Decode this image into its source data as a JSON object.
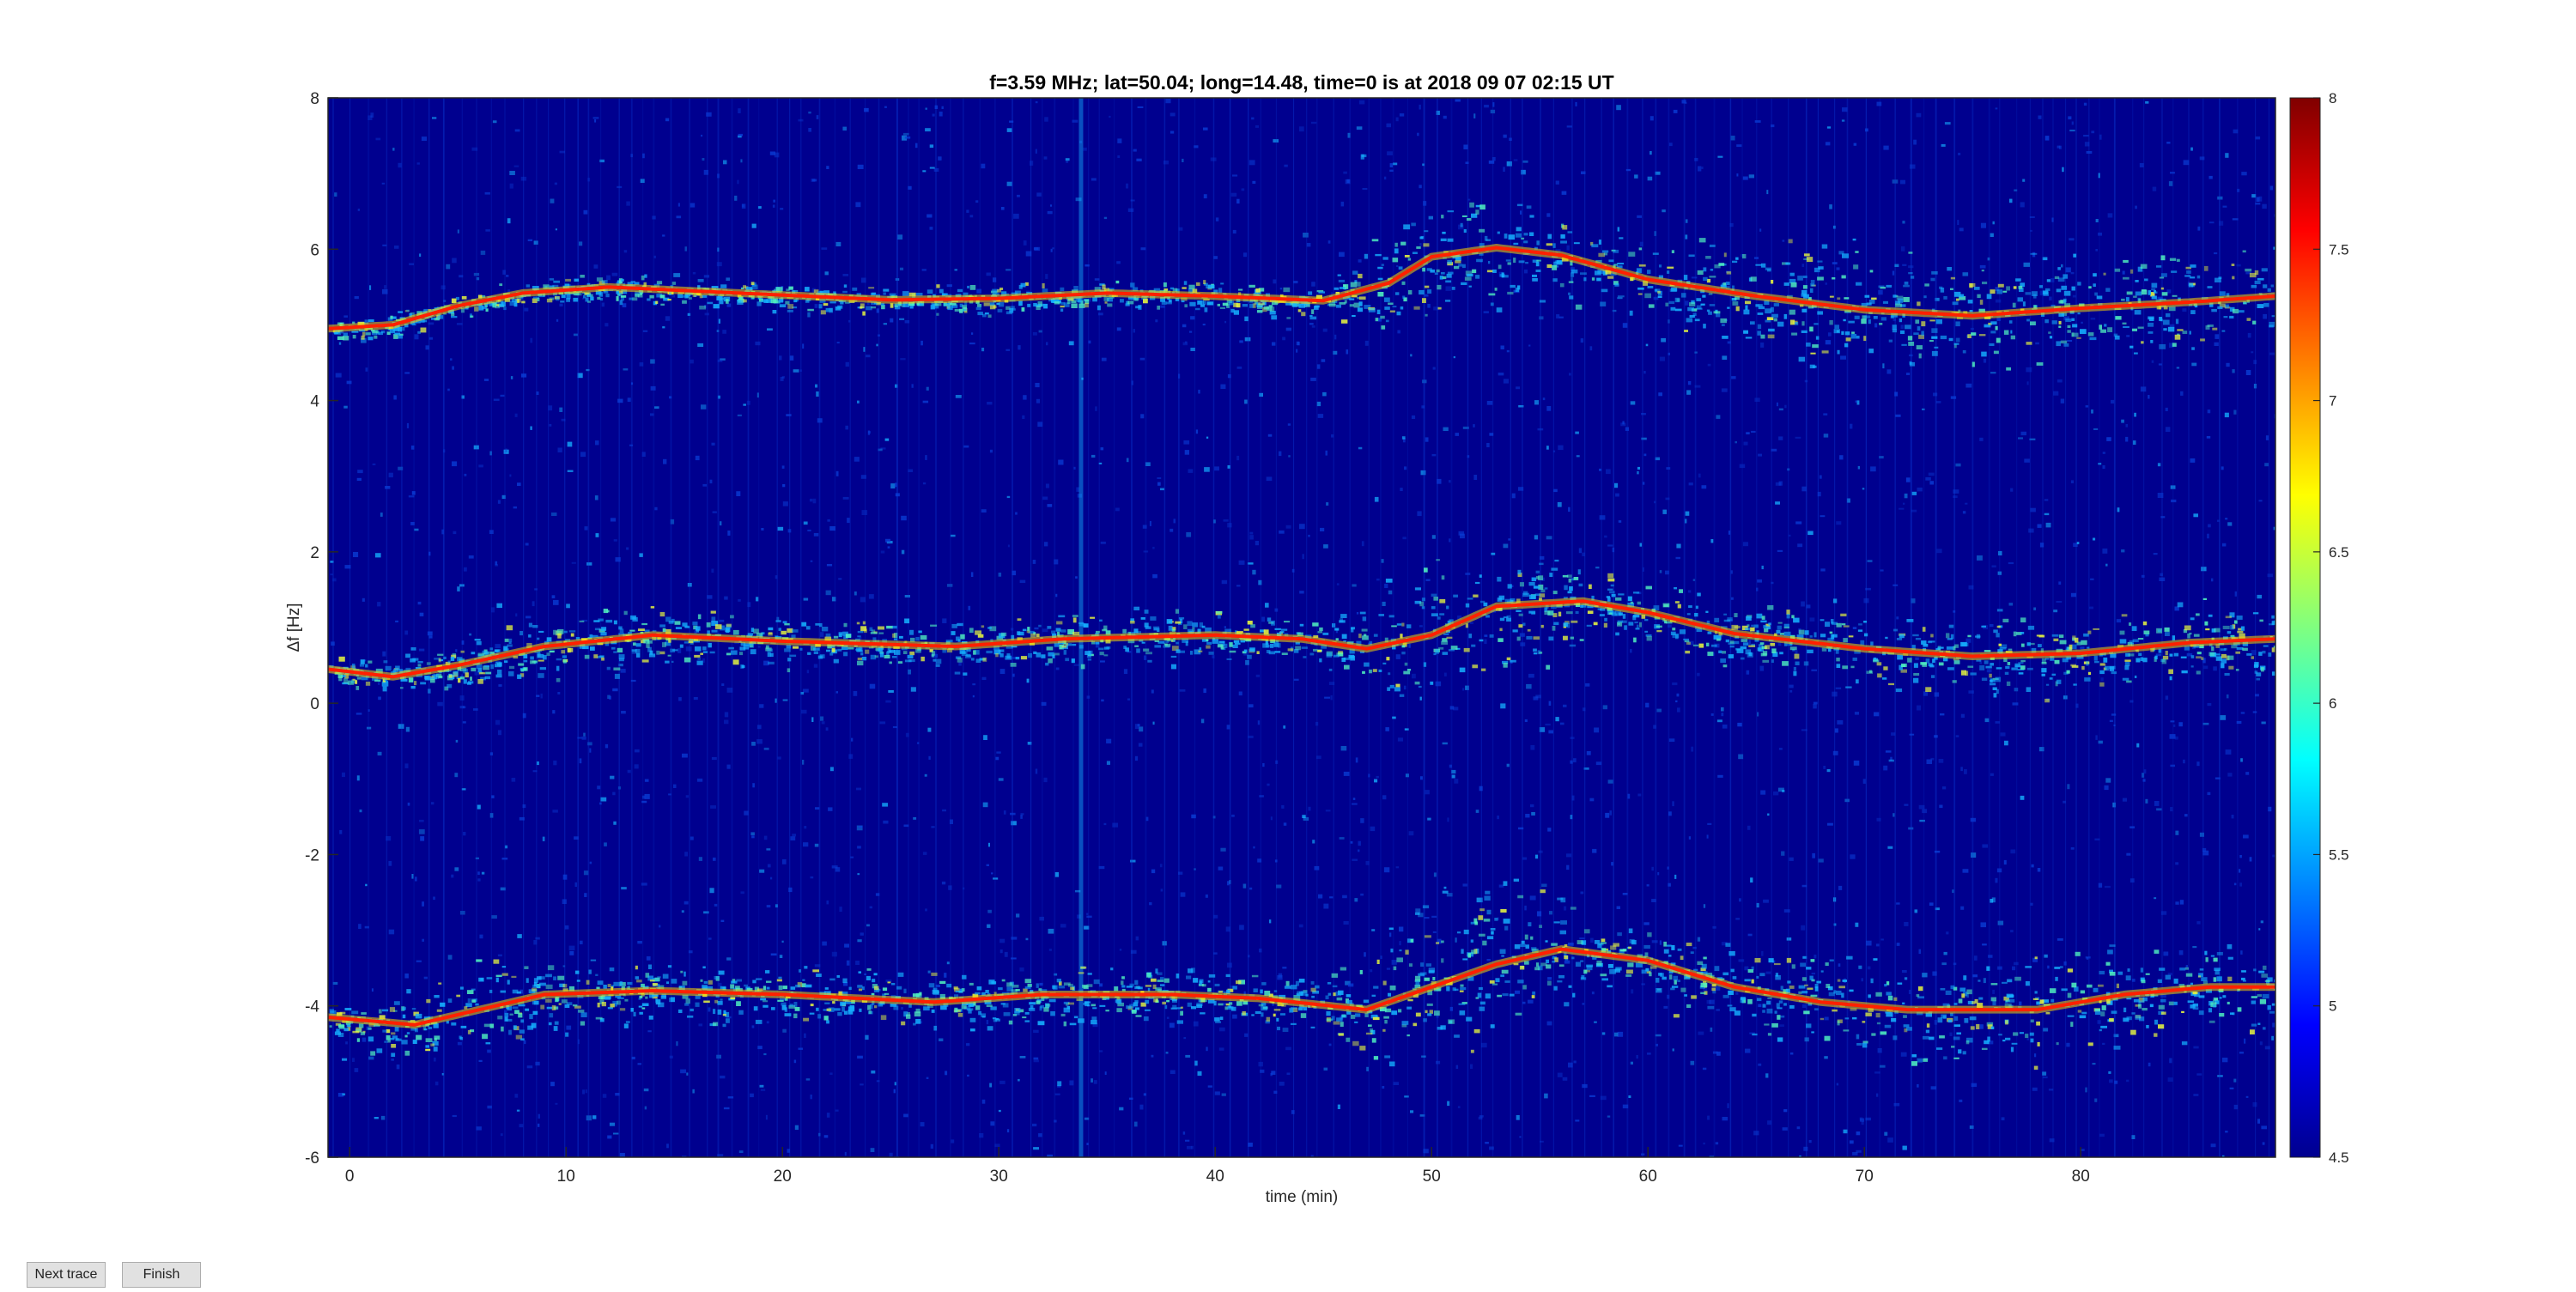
{
  "chart_data": {
    "type": "heatmap",
    "title": "f=3.59 MHz;  lat=50.04; long=14.48, time=0 is at 2018 09 07 02:15 UT",
    "xlabel": "time (min)",
    "ylabel": "Δf [Hz]",
    "xlim": [
      -1,
      89
    ],
    "ylim": [
      -6,
      8
    ],
    "xticks": [
      0,
      10,
      20,
      30,
      40,
      50,
      60,
      70,
      80
    ],
    "yticks": [
      -6,
      -4,
      -2,
      0,
      2,
      4,
      6,
      8
    ],
    "colorbar": {
      "range": [
        4.5,
        8
      ],
      "ticks": [
        4.5,
        5,
        5.5,
        6,
        6.5,
        7,
        7.5,
        8
      ],
      "colormap": "jet"
    },
    "colors": {
      "background": "#00008f",
      "noise": "#0a3fd8",
      "speckle": "#15b0ff",
      "peak": "#ff2000"
    },
    "traces": [
      {
        "points": [
          [
            -1,
            4.95
          ],
          [
            2,
            5.0
          ],
          [
            5,
            5.25
          ],
          [
            8,
            5.42
          ],
          [
            12,
            5.5
          ],
          [
            18,
            5.42
          ],
          [
            25,
            5.33
          ],
          [
            30,
            5.35
          ],
          [
            35,
            5.42
          ],
          [
            40,
            5.38
          ],
          [
            45,
            5.32
          ],
          [
            48,
            5.55
          ],
          [
            50,
            5.9
          ],
          [
            53,
            6.02
          ],
          [
            56,
            5.92
          ],
          [
            60,
            5.6
          ],
          [
            65,
            5.38
          ],
          [
            70,
            5.2
          ],
          [
            75,
            5.12
          ],
          [
            80,
            5.22
          ],
          [
            85,
            5.3
          ],
          [
            89,
            5.38
          ]
        ],
        "spread": [
          [
            -1,
            0.1
          ],
          [
            45,
            0.12
          ],
          [
            48,
            0.45
          ],
          [
            53,
            0.5
          ],
          [
            58,
            0.3
          ],
          [
            65,
            0.45
          ],
          [
            80,
            0.4
          ],
          [
            89,
            0.35
          ]
        ]
      },
      {
        "points": [
          [
            -1,
            0.45
          ],
          [
            2,
            0.35
          ],
          [
            5,
            0.5
          ],
          [
            9,
            0.75
          ],
          [
            14,
            0.9
          ],
          [
            20,
            0.82
          ],
          [
            28,
            0.75
          ],
          [
            33,
            0.85
          ],
          [
            40,
            0.9
          ],
          [
            44,
            0.85
          ],
          [
            47,
            0.72
          ],
          [
            50,
            0.9
          ],
          [
            53,
            1.28
          ],
          [
            57,
            1.35
          ],
          [
            60,
            1.2
          ],
          [
            64,
            0.92
          ],
          [
            70,
            0.72
          ],
          [
            75,
            0.62
          ],
          [
            80,
            0.66
          ],
          [
            85,
            0.8
          ],
          [
            89,
            0.85
          ]
        ],
        "spread": [
          [
            -1,
            0.1
          ],
          [
            8,
            0.25
          ],
          [
            20,
            0.2
          ],
          [
            45,
            0.2
          ],
          [
            48,
            0.5
          ],
          [
            53,
            0.55
          ],
          [
            58,
            0.25
          ],
          [
            75,
            0.3
          ],
          [
            89,
            0.3
          ]
        ]
      },
      {
        "points": [
          [
            -1,
            -4.15
          ],
          [
            3,
            -4.25
          ],
          [
            6,
            -4.05
          ],
          [
            9,
            -3.85
          ],
          [
            14,
            -3.8
          ],
          [
            20,
            -3.85
          ],
          [
            27,
            -3.95
          ],
          [
            32,
            -3.85
          ],
          [
            38,
            -3.85
          ],
          [
            42,
            -3.9
          ],
          [
            47,
            -4.05
          ],
          [
            50,
            -3.75
          ],
          [
            53,
            -3.45
          ],
          [
            56,
            -3.25
          ],
          [
            60,
            -3.4
          ],
          [
            64,
            -3.75
          ],
          [
            68,
            -3.95
          ],
          [
            72,
            -4.05
          ],
          [
            78,
            -4.05
          ],
          [
            82,
            -3.85
          ],
          [
            86,
            -3.75
          ],
          [
            89,
            -3.75
          ]
        ],
        "spread": [
          [
            -1,
            0.12
          ],
          [
            6,
            0.4
          ],
          [
            12,
            0.22
          ],
          [
            45,
            0.22
          ],
          [
            48,
            0.6
          ],
          [
            53,
            0.7
          ],
          [
            58,
            0.25
          ],
          [
            65,
            0.35
          ],
          [
            72,
            0.45
          ],
          [
            89,
            0.3
          ]
        ]
      }
    ]
  },
  "buttons": {
    "next_trace": "Next trace",
    "finish": "Finish"
  }
}
